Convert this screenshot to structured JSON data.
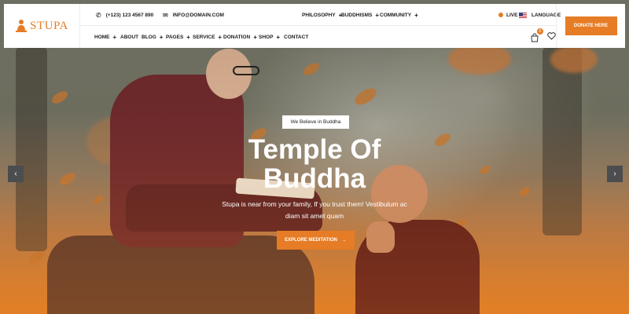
{
  "brand": {
    "name": "STUPA",
    "accent": "#e67c25"
  },
  "topbar": {
    "phone": "(+123) 123 4567 890",
    "email": "INFO@DOMAIN.COM",
    "links": [
      "PHILOSOPHY",
      "BUDDHISMS",
      "COMMUNITY"
    ],
    "live_label": "LIVE",
    "language_label": "LANGUAGE"
  },
  "nav": {
    "items": [
      {
        "label": "HOME",
        "has_submenu": true
      },
      {
        "label": "ABOUT",
        "has_submenu": false
      },
      {
        "label": "BLOG",
        "has_submenu": true
      },
      {
        "label": "PAGES",
        "has_submenu": true
      },
      {
        "label": "SERVICE",
        "has_submenu": true
      },
      {
        "label": "DONATION",
        "has_submenu": true
      },
      {
        "label": "SHOP",
        "has_submenu": true
      },
      {
        "label": "CONTACT",
        "has_submenu": false
      }
    ],
    "cart_count": "0",
    "donate_label": "DONATE HERE"
  },
  "hero": {
    "tagline": "We Believe in Buddha",
    "title_line1": "Temple Of",
    "title_line2": "Buddha",
    "subtitle_line1": "Stupa is near from your family, If you trust them! Vestibulum ac",
    "subtitle_line2": "diam sit amet quam",
    "cta_label": "EXPLORE MEDITATION"
  }
}
